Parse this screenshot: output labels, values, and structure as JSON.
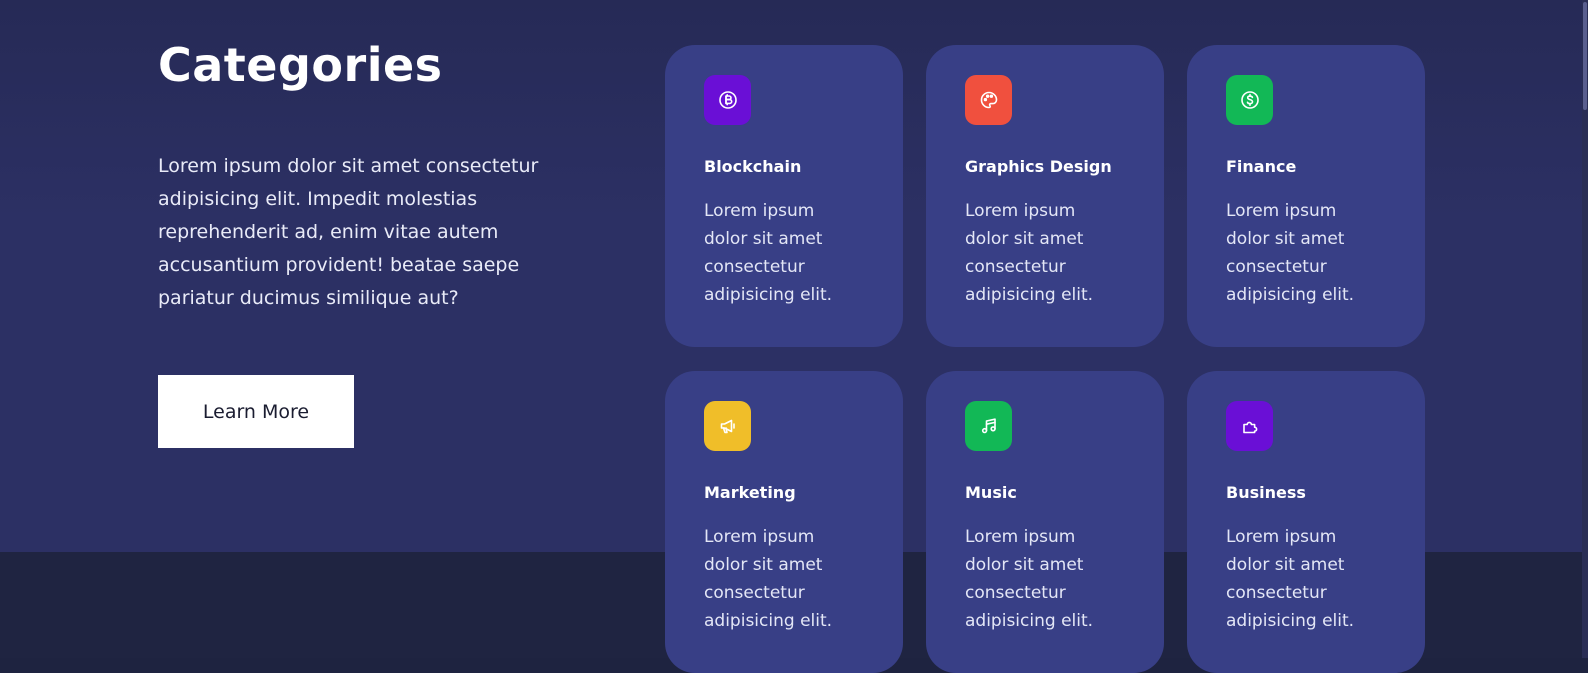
{
  "section": {
    "title": "Categories",
    "description": "Lorem ipsum dolor sit amet consectetur adipisicing elit. Impedit molestias reprehenderit ad, enim vitae autem accusantium provident! beatae saepe pariatur ducimus similique aut?",
    "learn_more_label": "Learn More"
  },
  "colors": {
    "background": "#2c3064",
    "card": "#383f86",
    "lower_band": "#1f2441"
  },
  "cards": [
    {
      "name": "Blockchain",
      "text": "Lorem ipsum dolor sit amet consectetur adipisicing elit.",
      "icon": "bitcoin-icon",
      "color": "#6a0fd6"
    },
    {
      "name": "Graphics Design",
      "text": "Lorem ipsum dolor sit amet consectetur adipisicing elit.",
      "icon": "palette-icon",
      "color": "#f0503e"
    },
    {
      "name": "Finance",
      "text": "Lorem ipsum dolor sit amet consectetur adipisicing elit.",
      "icon": "dollar-coin-icon",
      "color": "#12b856"
    },
    {
      "name": "Marketing",
      "text": "Lorem ipsum dolor sit amet consectetur adipisicing elit.",
      "icon": "megaphone-icon",
      "color": "#f0be29"
    },
    {
      "name": "Music",
      "text": "Lorem ipsum dolor sit amet consectetur adipisicing elit.",
      "icon": "music-note-icon",
      "color": "#12b856"
    },
    {
      "name": "Business",
      "text": "Lorem ipsum dolor sit amet consectetur adipisicing elit.",
      "icon": "puzzle-icon",
      "color": "#6a0fd6"
    }
  ]
}
